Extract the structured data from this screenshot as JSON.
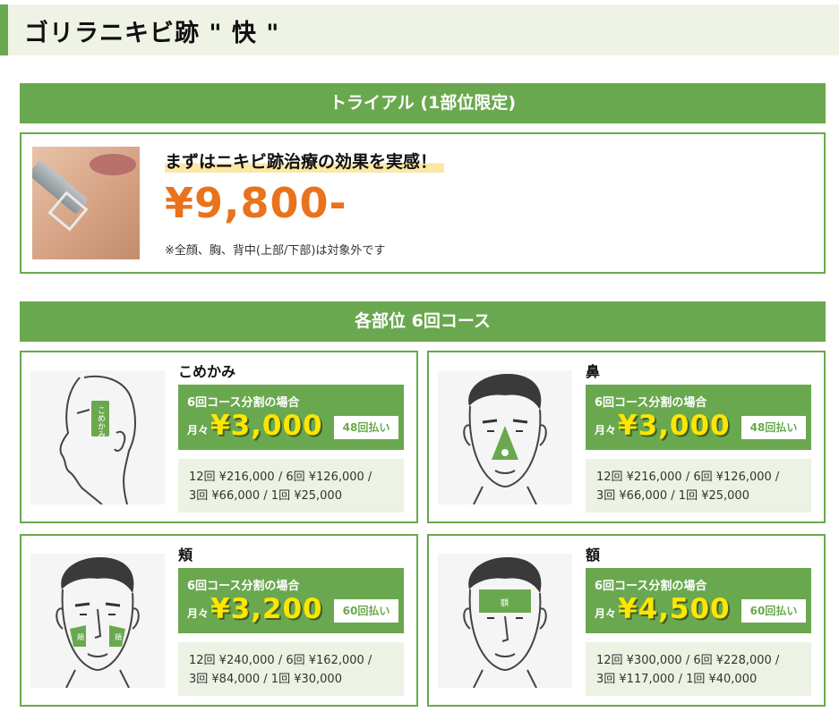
{
  "page": {
    "title": "ゴリラニキビ跡 \" 快 \""
  },
  "trial": {
    "banner": "トライアル (1部位限定)",
    "tagline": "まずはニキビ跡治療の効果を実感！",
    "price": "¥9,800-",
    "note": "※全顔、胸、背中(上部/下部)は対象外です"
  },
  "courses": {
    "banner": "各部位 6回コース",
    "monthly_label": "月々",
    "items": [
      {
        "title": "こめかみ",
        "illustration_label": "こめかみ",
        "plan_label": "6回コース分割の場合",
        "monthly_price": "¥3,000",
        "installments": "48回払い",
        "price_line1": "12回 ¥216,000 / 6回 ¥126,000 /",
        "price_line2": "3回 ¥66,000 / 1回 ¥25,000"
      },
      {
        "title": "鼻",
        "illustration_label": "",
        "plan_label": "6回コース分割の場合",
        "monthly_price": "¥3,000",
        "installments": "48回払い",
        "price_line1": "12回 ¥216,000 / 6回 ¥126,000 /",
        "price_line2": "3回 ¥66,000 / 1回 ¥25,000"
      },
      {
        "title": "頬",
        "illustration_label": "頬",
        "plan_label": "6回コース分割の場合",
        "monthly_price": "¥3,200",
        "installments": "60回払い",
        "price_line1": "12回 ¥240,000 / 6回 ¥162,000 /",
        "price_line2": "3回 ¥84,000 / 1回 ¥30,000"
      },
      {
        "title": "額",
        "illustration_label": "額",
        "plan_label": "6回コース分割の場合",
        "monthly_price": "¥4,500",
        "installments": "60回払い",
        "price_line1": "12回 ¥300,000 / 6回 ¥228,000 /",
        "price_line2": "3回 ¥117,000 / 1回 ¥40,000"
      }
    ]
  },
  "colors": {
    "accent": "#6aa84f",
    "price": "#e8731c",
    "highlight": "#ffe600"
  }
}
